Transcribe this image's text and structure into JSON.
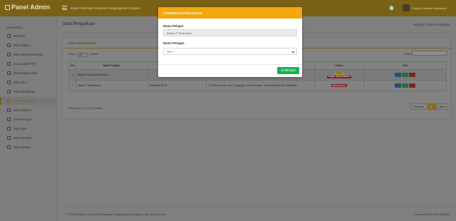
{
  "app": {
    "brand": "Panel Admin",
    "site_name": "Sistem Informasi Pelayanan Pengangkutan Sampah",
    "user_name": "Reyhy Pradisto Rudiharton"
  },
  "sidebar": {
    "title": "MAIN MENU",
    "items": [
      {
        "label": "Beranda",
        "icon": "home-icon"
      },
      {
        "label": "Data Angkut",
        "icon": "truck-icon"
      },
      {
        "label": "Data Jenis Kendaraan",
        "icon": "car-icon"
      },
      {
        "label": "Data Lokasi TPS",
        "icon": "map-pin-icon"
      },
      {
        "label": "Data Kriteria Jalur",
        "icon": "route-icon"
      },
      {
        "label": "Data Jalur",
        "icon": "road-icon"
      },
      {
        "label": "Data Kendaraan",
        "icon": "vehicle-icon"
      },
      {
        "label": "Data Pengaduan",
        "icon": "chat-icon",
        "active": true
      },
      {
        "label": "Data Laporan",
        "icon": "report-icon"
      },
      {
        "label": "Data Petugas",
        "icon": "users-icon"
      },
      {
        "label": "Data User",
        "icon": "user-icon"
      },
      {
        "label": "Data Gambar",
        "icon": "image-icon"
      },
      {
        "label": "Data Kontak",
        "icon": "contact-icon"
      }
    ]
  },
  "header": {
    "page_title": "Data Pengaduan",
    "breadcrumb_home": "Beranda",
    "breadcrumb_sep": "/",
    "breadcrumb_current": "Data Pengaduan"
  },
  "card": {
    "title": "DATA PENGADUAN",
    "show_prefix": "Show",
    "show_value": "10",
    "show_suffix": "entries",
    "search_label": "Search:"
  },
  "table": {
    "columns": [
      "No",
      "Nama Pelapor",
      "",
      "",
      "Status",
      "Aksi"
    ],
    "rows": [
      {
        "no": "1",
        "name": "Reyhy Pradisto Rudiharton",
        "phone": "",
        "address": "... Kel. 06, ...",
        "status": [
          "Proses",
          "Petugas : Reyhy Rudiharton"
        ]
      },
      {
        "no": "2",
        "name": "Reyhy P Rudiharton",
        "phone": "088286878778",
        "address": "Jl. Pelita No.18, Lkrs, Dangsgu, Kota Denukan, Semarang 59139, Indonesia",
        "status": [
          "Belum Di Proses"
        ]
      }
    ],
    "info": "Showing 1 to 2 of 2 entries",
    "pager": {
      "prev": "Previous",
      "current": "1",
      "next": "Next"
    }
  },
  "footer": {
    "copyright": "© 2022 Sistem Informasi Pelayanan Pengangkutan Sampah. All right reserved",
    "powered": "Powered By © 015 WebDev"
  },
  "modal": {
    "title": "KONFIRMASI PENGADUAN",
    "close": "×",
    "reporter_label": "Nama Pelapor",
    "reporter_value": "Reyhy P Rudiharton",
    "officer_label": "Nama Petugas",
    "officer_placeholder": "Pilih--",
    "confirm_label": "Konfirmasi"
  },
  "colors": {
    "topbar": "#7a6115",
    "modal_header": "#f5a70b",
    "confirm": "#18b455"
  }
}
